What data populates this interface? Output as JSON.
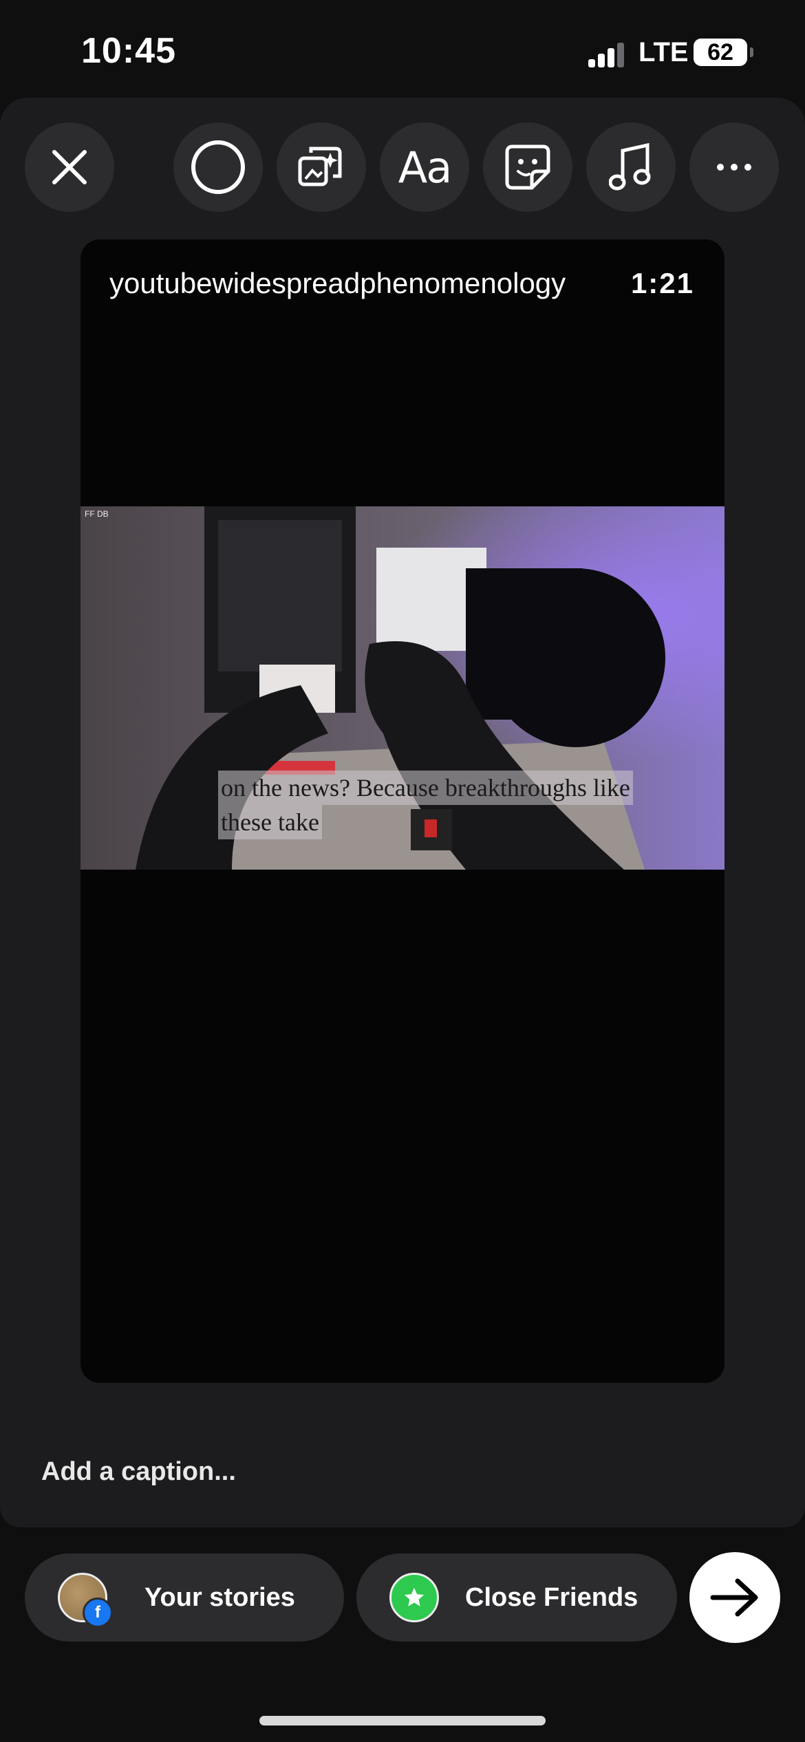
{
  "status_bar": {
    "time": "10:45",
    "network": "LTE",
    "battery": "62"
  },
  "toolbar": {
    "close_icon": "close-icon",
    "tools": [
      "circle-icon",
      "effects-icon",
      "text-icon",
      "sticker-icon",
      "music-icon",
      "more-icon"
    ],
    "text_tool_label": "Aa"
  },
  "story": {
    "username": "youtubewidespreadphenomenology",
    "duration": "1:21",
    "subtitle_line1": "on the news? Because breakthroughs like",
    "subtitle_line2": "these take",
    "watermark": "FF DB"
  },
  "caption": {
    "placeholder": "Add a caption..."
  },
  "share": {
    "your_stories": "Your stories",
    "close_friends": "Close Friends",
    "colors": {
      "close_friends_green": "#2ec94f",
      "facebook_blue": "#1877f2"
    }
  }
}
